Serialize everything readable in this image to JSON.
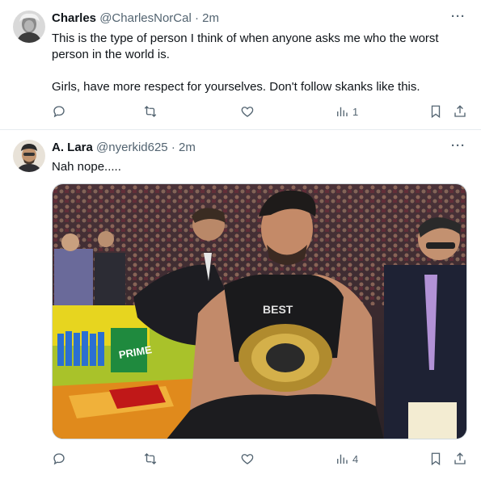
{
  "colors": {
    "text": "#0f1419",
    "muted": "#536471",
    "divider": "#e6ecf0"
  },
  "tweets": [
    {
      "display_name": "Charles",
      "handle": "@CharlesNorCal",
      "separator": "·",
      "time": "2m",
      "text_lines": [
        "This is the type of person I think of when anyone asks me who the worst person in the world is.",
        "Girls, have more respect for yourselves.  Don't follow skanks like this."
      ],
      "views": "1",
      "icons": [
        "avatar-photo",
        "more-icon",
        "reply-icon",
        "retweet-icon",
        "like-icon",
        "views-icon",
        "bookmark-icon",
        "share-icon"
      ]
    },
    {
      "display_name": "A. Lara",
      "handle": "@nyerkid625",
      "separator": "·",
      "time": "2m",
      "text_lines": [
        "Nah nope....."
      ],
      "media": {
        "shirt_text": "BEST",
        "banner_text": "PRIME"
      },
      "views": "4",
      "icons": [
        "avatar-photo",
        "more-icon",
        "reply-icon",
        "retweet-icon",
        "like-icon",
        "views-icon",
        "bookmark-icon",
        "share-icon"
      ]
    }
  ]
}
